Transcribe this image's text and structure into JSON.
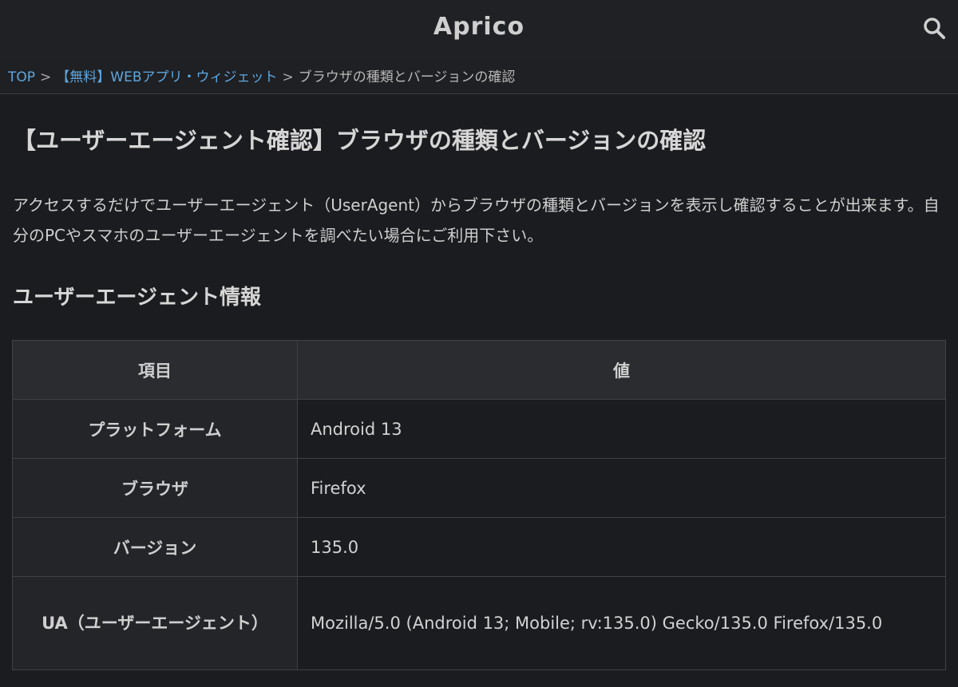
{
  "header": {
    "site_title": "Aprico",
    "search_icon": "search-icon"
  },
  "breadcrumb": {
    "items": [
      {
        "label": "TOP"
      },
      {
        "label": "【無料】WEBアプリ・ウィジェット"
      },
      {
        "label": "ブラウザの種類とバージョンの確認"
      }
    ],
    "separator": ">"
  },
  "page": {
    "title": "【ユーザーエージェント確認】ブラウザの種類とバージョンの確認",
    "intro": "アクセスするだけでユーザーエージェント（UserAgent）からブラウザの種類とバージョンを表示し確認することが出来ます。自分のPCやスマホのユーザーエージェントを調べたい場合にご利用下さい。",
    "section_heading": "ユーザーエージェント情報"
  },
  "table": {
    "headers": {
      "key": "項目",
      "value": "値"
    },
    "rows": [
      {
        "label": "プラットフォーム",
        "value": "Android 13"
      },
      {
        "label": "ブラウザ",
        "value": "Firefox"
      },
      {
        "label": "バージョン",
        "value": "135.0"
      },
      {
        "label": "UA（ユーザーエージェント）",
        "value": "Mozilla/5.0 (Android 13; Mobile; rv:135.0) Gecko/135.0 Firefox/135.0"
      }
    ]
  },
  "colors": {
    "background": "#1b1c1f",
    "header_bg": "#202124",
    "link": "#5fa7e0",
    "table_header_bg": "#2a2c30"
  }
}
